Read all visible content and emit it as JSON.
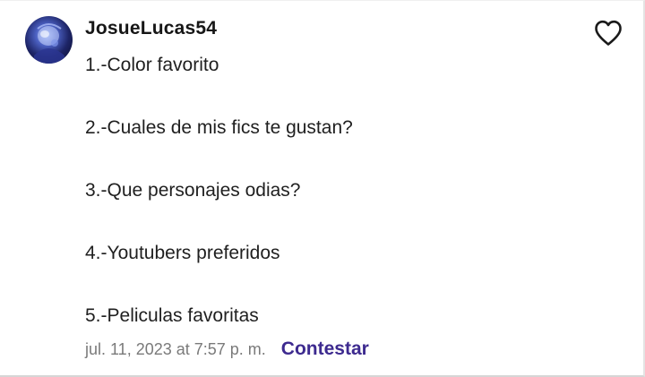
{
  "comment": {
    "author": "JosueLucas54",
    "avatar_icon": "user-avatar",
    "like_icon": "heart-outline-icon",
    "lines": [
      "1.-Color favorito",
      "2.-Cuales de mis fics te gustan?",
      "3.-Que personajes odias?",
      "4.-Youtubers preferidos",
      "5.-Peliculas favoritas"
    ],
    "timestamp": "jul. 11, 2023 at 7:57 p. m.",
    "reply_label": "Contestar"
  },
  "colors": {
    "reply_accent": "#3d2a8f",
    "username": "#161616",
    "timestamp": "#7a7a7a"
  }
}
